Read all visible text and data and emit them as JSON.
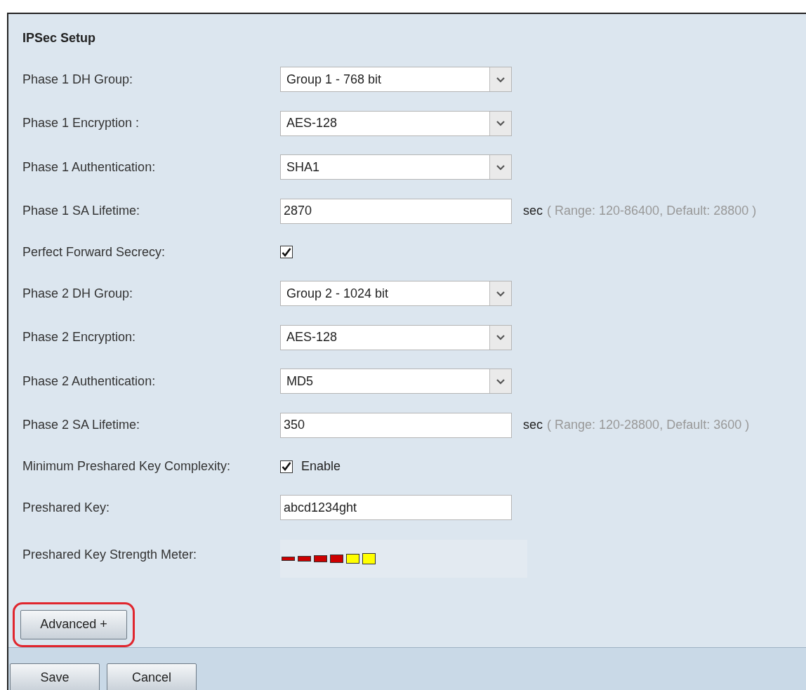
{
  "section_title": "IPSec Setup",
  "fields": [
    {
      "kind": "select",
      "label": "Phase 1 DH Group:",
      "value": "Group 1 - 768 bit"
    },
    {
      "kind": "select",
      "label": "Phase 1 Encryption :",
      "value": "AES-128"
    },
    {
      "kind": "select",
      "label": "Phase 1 Authentication:",
      "value": "SHA1"
    },
    {
      "kind": "text",
      "label": "Phase 1 SA Lifetime:",
      "value": "2870",
      "unit": "sec",
      "hint": "( Range: 120-86400, Default: 28800 )"
    },
    {
      "kind": "checkbox",
      "label": "Perfect Forward Secrecy:",
      "checked": true
    },
    {
      "kind": "select",
      "label": "Phase 2 DH Group:",
      "value": "Group 2 - 1024 bit"
    },
    {
      "kind": "select",
      "label": "Phase 2 Encryption:",
      "value": "AES-128"
    },
    {
      "kind": "select",
      "label": "Phase 2 Authentication:",
      "value": "MD5"
    },
    {
      "kind": "text",
      "label": "Phase 2 SA Lifetime:",
      "value": "350",
      "unit": "sec",
      "hint": "( Range: 120-28800, Default: 3600 )"
    },
    {
      "kind": "checkbox",
      "label": "Minimum Preshared Key Complexity:",
      "checked": true,
      "option": "Enable"
    },
    {
      "kind": "text",
      "label": "Preshared Key:",
      "value": "abcd1234ght"
    },
    {
      "kind": "meter",
      "label": "Preshared Key Strength Meter:",
      "segments": [
        {
          "color": "#cc0000"
        },
        {
          "color": "#cc0000"
        },
        {
          "color": "#cc0000"
        },
        {
          "color": "#cc0000"
        },
        {
          "color": "#ffff00"
        },
        {
          "color": "#ffff00"
        }
      ]
    }
  ],
  "advanced_button": {
    "label": "Advanced +",
    "highlighted": true
  },
  "buttons": [
    "Save",
    "Cancel"
  ]
}
